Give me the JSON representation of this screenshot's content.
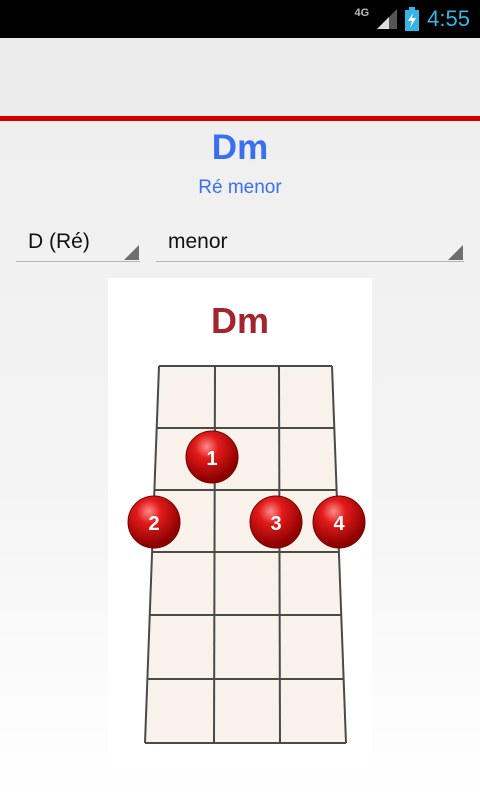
{
  "statusbar": {
    "network": "4G",
    "time": "4:55"
  },
  "chord": {
    "name": "Dm",
    "full_name": "Ré menor"
  },
  "selectors": {
    "root": "D (Ré)",
    "quality": "menor"
  },
  "diagram": {
    "title": "Dm",
    "fingers": [
      "1",
      "2",
      "3",
      "4"
    ]
  }
}
